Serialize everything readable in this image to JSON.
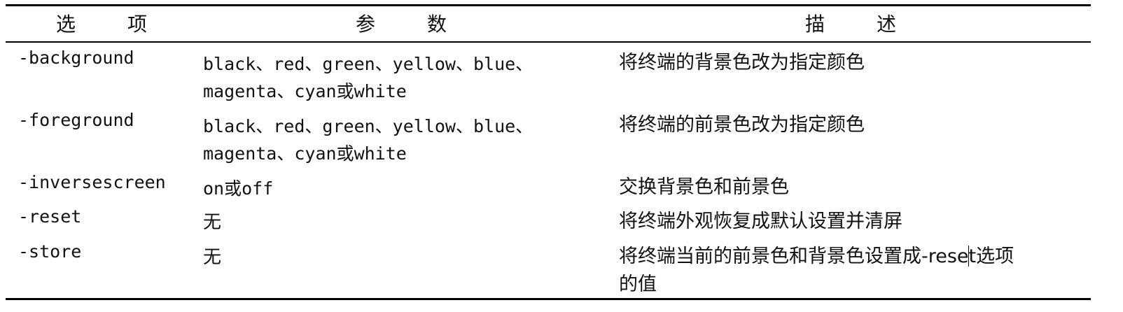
{
  "headers": {
    "option": [
      "选",
      "项"
    ],
    "param": [
      "参",
      "数"
    ],
    "desc": [
      "描",
      "述"
    ]
  },
  "rows": [
    {
      "option": "-background",
      "param_lines": [
        "black、red、green、yellow、blue、",
        "magenta、cyan或white"
      ],
      "desc_lines": [
        "将终端的背景色改为指定颜色"
      ]
    },
    {
      "option": "-foreground",
      "param_lines": [
        "black、red、green、yellow、blue、",
        "magenta、cyan或white"
      ],
      "desc_lines": [
        "将终端的前景色改为指定颜色"
      ]
    },
    {
      "option": "-inversescreen",
      "param_lines": [
        "on或off"
      ],
      "desc_lines": [
        "交换背景色和前景色"
      ]
    },
    {
      "option": "-reset",
      "param_lines": [
        "无"
      ],
      "desc_lines": [
        "将终端外观恢复成默认设置并清屏"
      ]
    },
    {
      "option": "-store",
      "param_lines": [
        "无"
      ],
      "desc_lines": [
        "将终端当前的前景色和背景色设置成-rese",
        "的值"
      ],
      "desc_line1_after_caret": "t选项"
    }
  ]
}
